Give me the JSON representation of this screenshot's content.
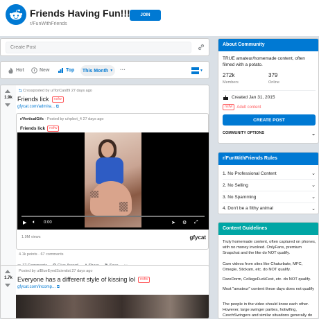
{
  "header": {
    "title": "Friends Having Fun!!!",
    "subreddit": "r/FunWithFriends",
    "join_label": "JOIN"
  },
  "create_post": {
    "placeholder": "Create Post"
  },
  "sort": {
    "items": [
      "Hot",
      "New",
      "Top"
    ],
    "active": "Top",
    "time_filter": "This Month",
    "more": "···"
  },
  "posts": [
    {
      "votes": "1.9k",
      "crosspost_meta": "Crossposted by u/TorCan89 27 days ago",
      "title": "Friends lick",
      "nsfw": "nsfw",
      "link": "gfycat.com/admira...",
      "crosspost": {
        "subreddit": "r/VerticalGifs",
        "meta": "· Posted by u/vpbot_4 27 days ago",
        "title": "Friends lick",
        "nsfw": "nsfw",
        "time": "0:00",
        "progress": 0.0,
        "views": "1.9M views",
        "brand": "gfycat"
      },
      "points": "4.1k points · 67 comments",
      "actions": [
        "17 Comments",
        "Give Award",
        "Share",
        "Save",
        "···"
      ]
    },
    {
      "votes": "1.7k",
      "meta": "Posted by u/BlueEyedScientist 27 days ago",
      "title": "Everyone has a different style of kissing lol",
      "nsfw": "nsfw",
      "link": "gfycat.com/incomp..."
    }
  ],
  "about": {
    "header": "About Community",
    "description": "TRUE amateur/homemade content, often filmed with a potato.",
    "members_count": "272k",
    "members_label": "Members",
    "online_count": "379",
    "online_label": "Online",
    "created": "Created Jan 31, 2015",
    "nsfw": "nsfw",
    "adult_label": "Adult content",
    "create_post_label": "CREATE POST",
    "options_label": "COMMUNITY OPTIONS"
  },
  "rules": {
    "header": "r/FunWithFriends Rules",
    "items": [
      "1. No Professional Content",
      "2. No Selling",
      "3. No Spamming",
      "4. Don't be a filthy animal"
    ]
  },
  "guidelines": {
    "header": "Content Guidelines",
    "paragraphs": [
      "Truly homemade content, often captured on phones, with no money involved. OnlyFans, premium Snapchat and the like do NOT qualify.",
      "Cam videos from sites like Chaturbate, MFC, Omegle, Stickam, etc. do NOT qualify.",
      "DareDorm, CollegeFuckFest, etc. do NOT qualify.",
      "Most \"amateur\" content these days does not qualify",
      "The people in the video should know each other. However, large swinger parties, hotwifing, CzechSwingers and similar situations generally do"
    ]
  },
  "colors": {
    "accent": "#0079d3",
    "nsfw": "#ff585b",
    "teal": "#00a6a5",
    "background": "#dae0e6"
  }
}
